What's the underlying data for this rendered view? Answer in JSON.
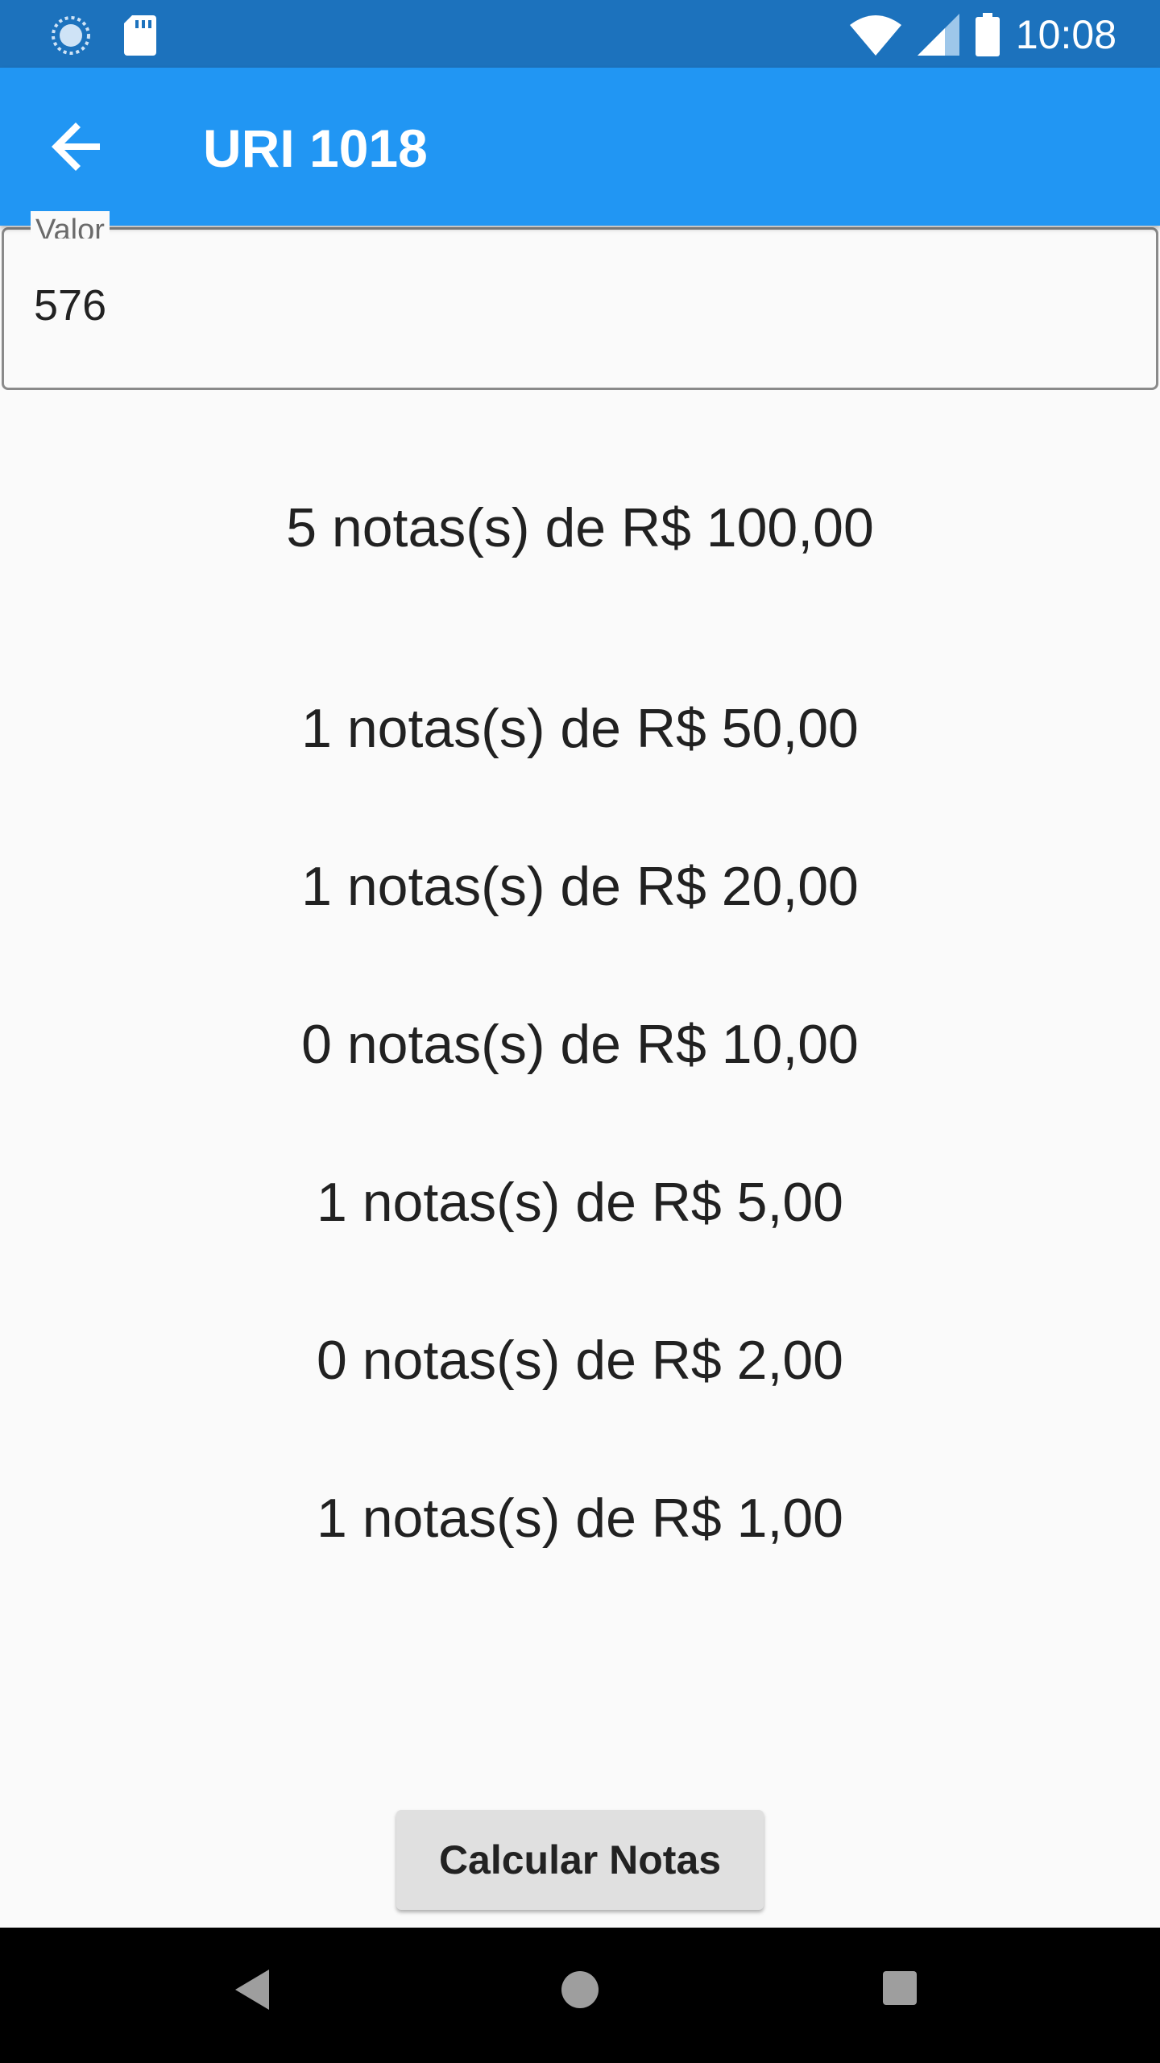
{
  "status_bar": {
    "time": "10:08",
    "left_icons": [
      "sync-icon",
      "sd-card-icon"
    ],
    "right_icons": [
      "wifi-icon",
      "signal-icon",
      "battery-icon"
    ]
  },
  "app_bar": {
    "title": "URI 1018",
    "back_icon": "arrow-back-icon",
    "color": "#2196f3"
  },
  "input": {
    "label": "Valor",
    "value": "576"
  },
  "results": [
    "5 notas(s) de R$ 100,00",
    "1 notas(s) de R$ 50,00",
    "1 notas(s) de R$ 20,00",
    "0 notas(s) de R$ 10,00",
    "1 notas(s) de R$ 5,00",
    "0 notas(s) de R$ 2,00",
    "1 notas(s) de R$ 1,00"
  ],
  "actions": {
    "calculate_label": "Calcular Notas"
  },
  "nav_bar": {
    "icons": [
      "nav-back-icon",
      "nav-home-icon",
      "nav-recents-icon"
    ]
  }
}
